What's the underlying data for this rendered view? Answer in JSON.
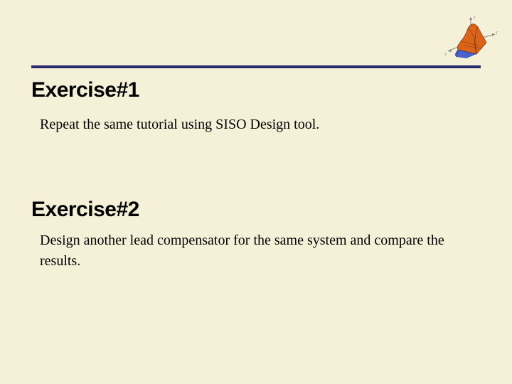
{
  "headings": {
    "h1": "Exercise#1",
    "h2": "Exercise#2"
  },
  "paragraphs": {
    "p1": "Repeat the same tutorial using SISO Design tool.",
    "p2": "Design another lead compensator for the same system and compare the results."
  },
  "logo": {
    "name": "matlab-logo"
  }
}
